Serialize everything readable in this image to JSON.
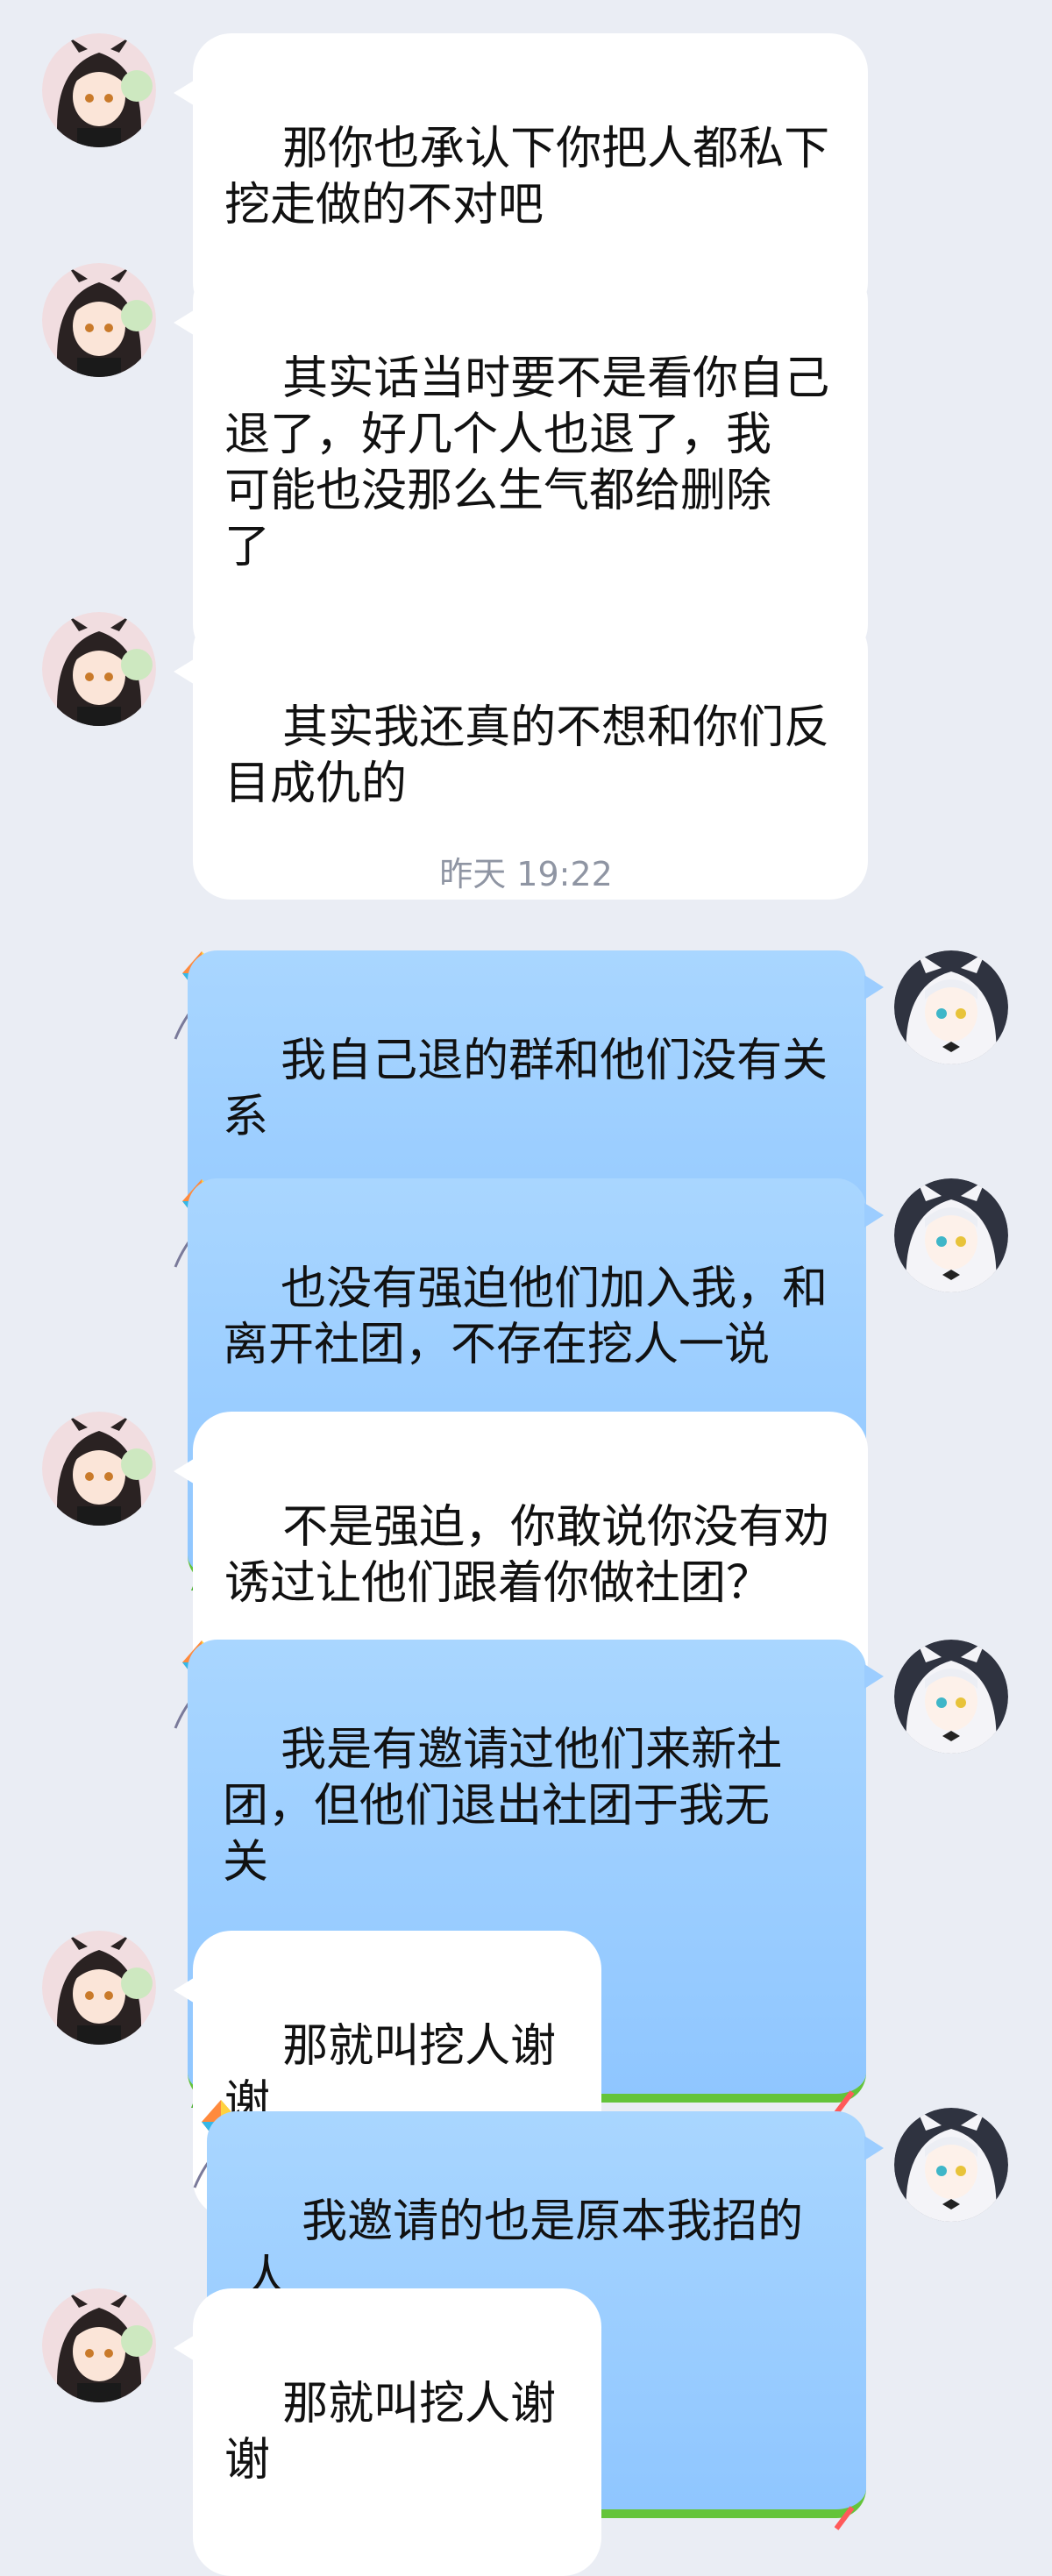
{
  "timestamp": "昨天 19:22",
  "messages": [
    {
      "side": "in",
      "text": "那你也承认下你把人都私下\n挖走做的不对吧"
    },
    {
      "side": "in",
      "text": "其实话当时要不是看你自己\n退了，好几个人也退了，我\n可能也没那么生气都给删除\n了"
    },
    {
      "side": "in",
      "text": "其实我还真的不想和你们反\n目成仇的"
    },
    {
      "side": "out",
      "text": "我自己退的群和他们没有关\n系"
    },
    {
      "side": "out",
      "text": "也没有强迫他们加入我，和\n离开社团，不存在挖人一说"
    },
    {
      "side": "in",
      "text": "不是强迫，你敢说你没有劝\n诱过让他们跟着你做社团？"
    },
    {
      "side": "out",
      "text": "我是有邀请过他们来新社\n团，但他们退出社团于我无\n关"
    },
    {
      "side": "in",
      "text": "那就叫挖人谢谢"
    },
    {
      "side": "out",
      "text": "我邀请的也是原本我招的人"
    },
    {
      "side": "in",
      "text": "那就叫挖人谢谢"
    }
  ],
  "colors": {
    "background": "#eaedf4",
    "incoming_bubble": "#ffffff",
    "outgoing_bubble": "#9ccdff",
    "outgoing_border": "#64c43a"
  },
  "icons": {
    "incoming_avatar": "avatar-dark-hair-girl",
    "outgoing_avatar": "avatar-white-cat-girl",
    "bubble_decoration": "kite-icon"
  }
}
